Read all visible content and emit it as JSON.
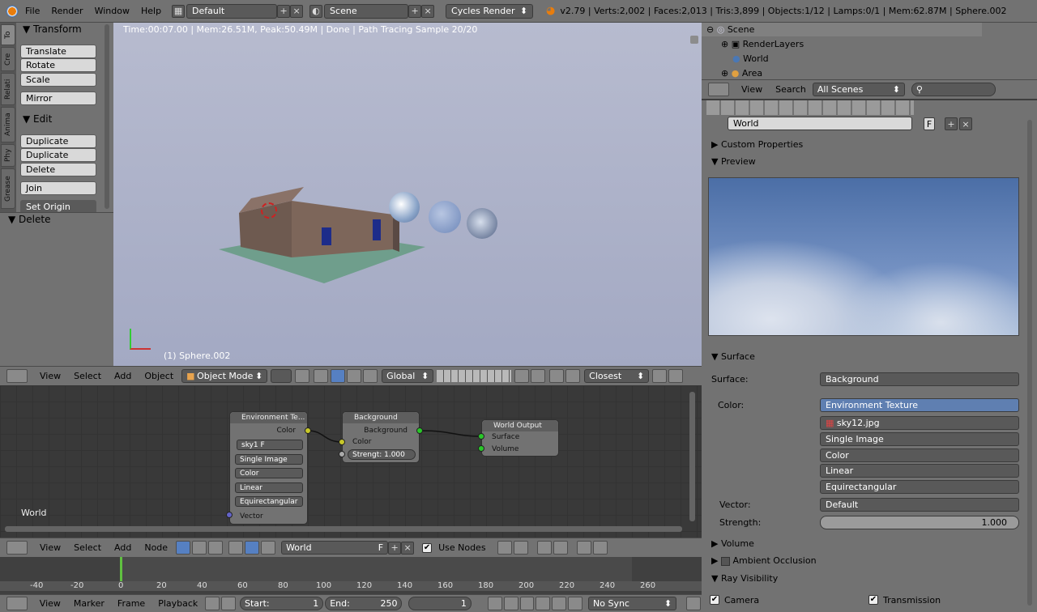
{
  "app": {
    "menu": [
      "File",
      "Render",
      "Window",
      "Help"
    ],
    "layout": "Default",
    "scene": "Scene",
    "engine": "Cycles Render",
    "stats": "v2.79 | Verts:2,002 | Faces:2,013 | Tris:3,899 | Objects:1/12 | Lamps:0/1 | Mem:62.87M | Sphere.002"
  },
  "toolshelf": {
    "tabs": [
      "To",
      "Cre",
      "Relati",
      "Anima",
      "Phy",
      "Grease"
    ],
    "transform_header": "Transform",
    "transform_buttons": [
      "Translate",
      "Rotate",
      "Scale",
      "Mirror"
    ],
    "edit_header": "Edit",
    "edit_buttons": [
      "Duplicate",
      "Duplicate Linked",
      "Delete",
      "Join",
      "Set Origin"
    ],
    "delete_header": "Delete"
  },
  "viewport": {
    "info": "Time:00:07.00 | Mem:26.51M, Peak:50.49M | Done | Path Tracing Sample 20/20",
    "object_label": "(1) Sphere.002",
    "header": {
      "menus": [
        "View",
        "Select",
        "Add",
        "Object"
      ],
      "mode": "Object Mode",
      "orientation": "Global",
      "snap": "Closest"
    }
  },
  "node_editor": {
    "world_label": "World",
    "env_node": {
      "title": "Environment Te...",
      "out_color": "Color",
      "image": "sky1",
      "f": "F",
      "projection": "Single Image",
      "color_space": "Color",
      "interp": "Linear",
      "mapping": "Equirectangular",
      "vector": "Vector"
    },
    "bg_node": {
      "title": "Background",
      "out": "Background",
      "color": "Color",
      "strength": "Strengt: 1.000"
    },
    "out_node": {
      "title": "World Output",
      "surface": "Surface",
      "volume": "Volume"
    },
    "header": {
      "menus": [
        "View",
        "Select",
        "Add",
        "Node"
      ],
      "world": "World",
      "f": "F",
      "use_nodes": "Use Nodes"
    }
  },
  "timeline": {
    "ticks": [
      "-40",
      "-20",
      "0",
      "20",
      "40",
      "60",
      "80",
      "100",
      "120",
      "140",
      "160",
      "180",
      "200",
      "220",
      "240",
      "260"
    ],
    "header": {
      "menus": [
        "View",
        "Marker",
        "Frame",
        "Playback"
      ],
      "start_label": "Start:",
      "start": "1",
      "end_label": "End:",
      "end": "250",
      "current": "1",
      "sync": "No Sync"
    }
  },
  "outliner": {
    "items": [
      "Scene",
      "RenderLayers",
      "World",
      "Area"
    ],
    "menus": [
      "View",
      "Search"
    ],
    "filter": "All Scenes"
  },
  "properties": {
    "world_name": "World",
    "f": "F",
    "custom_properties": "Custom Properties",
    "preview": "Preview",
    "surface_header": "Surface",
    "surface_label": "Surface:",
    "surface_value": "Background",
    "color_label": "Color:",
    "color_value": "Environment Texture",
    "image": "sky12.jpg",
    "projection": "Single Image",
    "color_space": "Color",
    "interp": "Linear",
    "mapping": "Equirectangular",
    "vector_label": "Vector:",
    "vector_value": "Default",
    "strength_label": "Strength:",
    "strength_value": "1.000",
    "volume": "Volume",
    "ao": "Ambient Occlusion",
    "ray_visibility": "Ray Visibility",
    "camera": "Camera",
    "transmission": "Transmission"
  }
}
